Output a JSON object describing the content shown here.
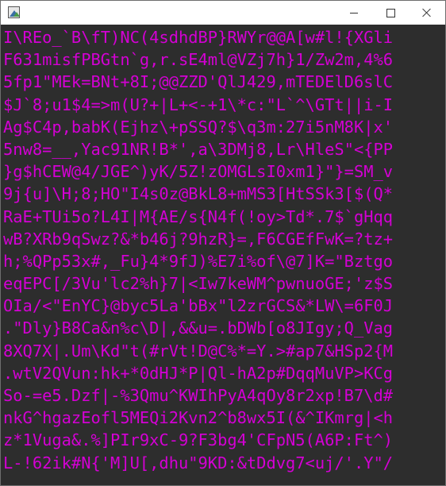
{
  "window": {
    "title": "",
    "icon": "app-window-icon",
    "controls": {
      "minimize_icon": "minimize-icon",
      "maximize_icon": "maximize-icon",
      "close_icon": "close-icon"
    }
  },
  "colors": {
    "background": "#2d2d2d",
    "text": "#d400d4",
    "titlebar": "#ffffff"
  },
  "terminal": {
    "lines": [
      "I\\REo_`B\\fT)NC(4sdhdBP}RWYr@@A[w#l!{XGli",
      "F631misfPBGtn`g,r.sE4ml@VZj7h}1/Zw2m,4%6",
      "5fp1\"MEk=BNt+8I;@@ZZD'QlJ429,mTEDElD6slC",
      "$J`8;u1$4=>m(U?+|L+<-+1\\*c:\"L`^\\GTt||i-I",
      "Ag$C4p,babK(Ejhz\\+pSSQ?$\\q3m:27i5nM8K|x'",
      "5nw8=__,Yac91NR!B*',a\\3DMj8,Lr\\HleS\"<{PP",
      "}g$hCEW@4/JGE^)yK/5Z!zOMGLsI0xm1}\"}=SM_v",
      "9j{u]\\H;8;HO\"I4s0z@BkL8+mMS3[HtSSk3[$(Q*",
      "RaE+TUi5o?L4I|M{AE/s{N4f(!oy>Td*.7$`gHqq",
      "wB?XRb9qSwz?&*b46j?9hzR}=,F6CGEfFwK=?tz+",
      "h;%QPp53x#,_Fu}4*9fJ)%E7i%of\\@7]K=\"Bztgo",
      "eqEPC[/3Vu'lc2%h}7|<Iw7keWM^pwnuoGE;'z$S",
      "OIa/<\"EnYC}@byc5La'bBx\"l2zrGCS&*LW\\=6F0J",
      ".\"Dly}B8Ca&n%c\\D|,&&u=.bDWb[o8JIgy;Q_Vag",
      "8XQ7X|.Um\\Kd\"t(#rVt!D@C%*=Y.>#ap7&HSp2{M",
      ".wtV2QVun:hk+*0dHJ*P|Ql-hA2p#DqqMuVP>KCg",
      "So-=e5.Dzf|-%3Qmu^KWIhPyA4qOy8r2xp!B7\\d#",
      "nkG^hgazEofl5MEQi2Kvn2^b8wx5I(&^IKmrg|<h",
      "z*1Vuga&.%]PIr9xC-9?F3bg4'CFpN5(A6P:Ft^)",
      "L-!62ik#N{'M]U[,dhu\"9KD:&tDdvg7<uj/'.Y\"/"
    ]
  }
}
